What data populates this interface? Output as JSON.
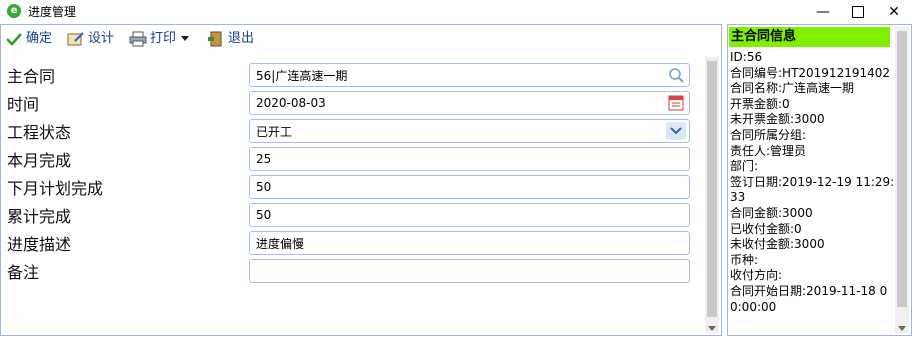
{
  "window": {
    "title": "进度管理"
  },
  "toolbar": {
    "confirm": "确定",
    "design": "设计",
    "print": "打印",
    "exit": "退出"
  },
  "form": {
    "rows": [
      {
        "label": "主合同",
        "value": "56|广连高速一期",
        "trail": "search-icon"
      },
      {
        "label": "时间",
        "value": "2020-08-03",
        "trail": "calendar-icon"
      },
      {
        "label": "工程状态",
        "value": "已开工",
        "trail": "chevron-down-icon"
      },
      {
        "label": "本月完成",
        "value": "25"
      },
      {
        "label": "下月计划完成",
        "value": "50"
      },
      {
        "label": "累计完成",
        "value": "50"
      },
      {
        "label": "进度描述",
        "value": "进度偏慢"
      },
      {
        "label": "备注",
        "value": ""
      }
    ]
  },
  "info": {
    "header": "主合同信息",
    "lines": [
      "ID:56",
      "合同编号:HT201912191402",
      "合同名称:广连高速一期",
      "开票金额:0",
      "未开票金额:3000",
      "合同所属分组:",
      "责任人:管理员",
      "部门:",
      "签订日期:2019-12-19 11:29:33",
      "合同金额:3000",
      "已收付金额:0",
      "未收付金额:3000",
      "币种:",
      "收付方向:",
      "合同开始日期:2019-11-18 00:00:00"
    ]
  }
}
